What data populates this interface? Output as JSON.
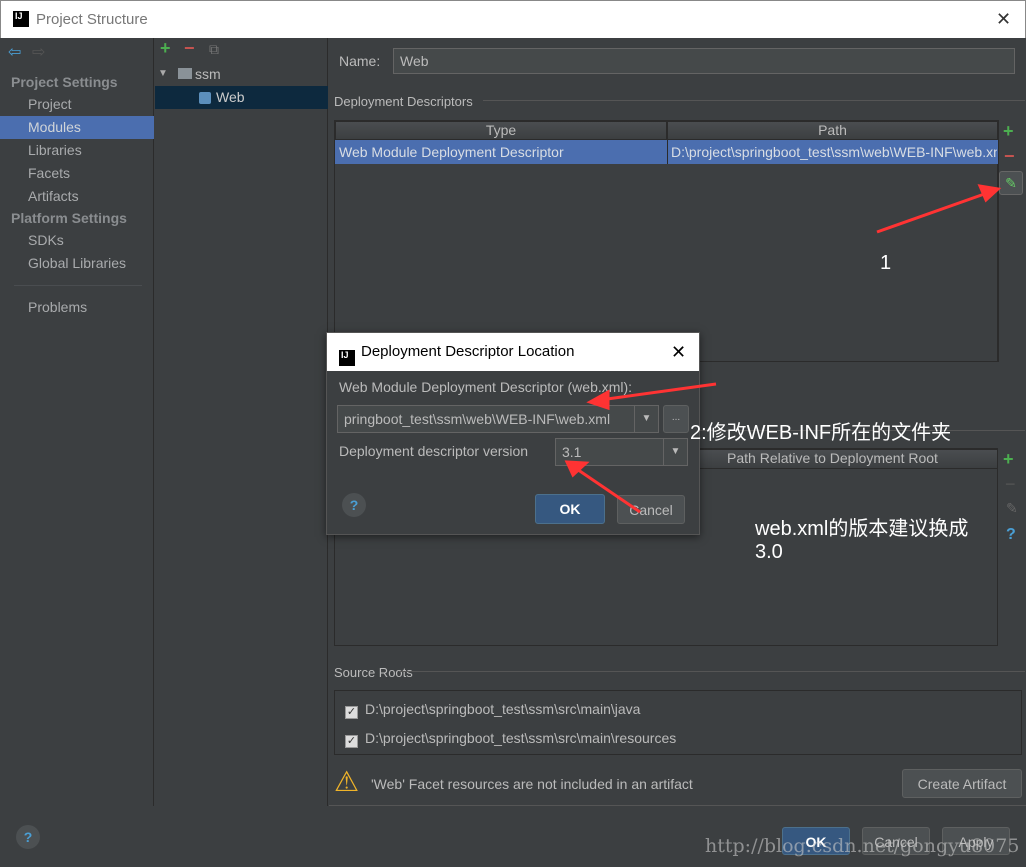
{
  "window": {
    "title": "Project Structure",
    "close": "✕"
  },
  "sidebar": {
    "sections": [
      {
        "header": "Project Settings",
        "items": [
          "Project",
          "Modules",
          "Libraries",
          "Facets",
          "Artifacts"
        ]
      },
      {
        "header": "Platform Settings",
        "items": [
          "SDKs",
          "Global Libraries"
        ]
      }
    ],
    "problems": "Problems",
    "selected": "Modules"
  },
  "tree": {
    "root": "ssm",
    "child": "Web"
  },
  "main": {
    "name_label": "Name:",
    "name_value": "Web",
    "descriptors_title": "Deployment Descriptors",
    "table": {
      "columns": [
        "Type",
        "Path"
      ],
      "rows": [
        [
          "Web Module Deployment Descriptor",
          "D:\\project\\springboot_test\\ssm\\web\\WEB-INF\\web.xml"
        ]
      ]
    },
    "web_resources_column": "Path Relative to Deployment Root",
    "source_roots_title": "Source Roots",
    "source_roots": [
      {
        "path": "D:\\project\\springboot_test\\ssm\\src\\main\\java",
        "checked": true
      },
      {
        "path": "D:\\project\\springboot_test\\ssm\\src\\main\\resources",
        "checked": true
      }
    ],
    "warning": "'Web' Facet resources are not included in an artifact",
    "create_artifact": "Create Artifact"
  },
  "footer": {
    "ok": "OK",
    "cancel": "Cancel",
    "apply": "Apply",
    "help": "?"
  },
  "dialog": {
    "title": "Deployment Descriptor Location",
    "descriptor_label": "Web Module Deployment Descriptor (web.xml):",
    "descriptor_value": "pringboot_test\\ssm\\web\\WEB-INF\\web.xml",
    "browse": "...",
    "version_label": "Deployment descriptor version",
    "version_value": "3.1",
    "ok": "OK",
    "cancel": "Cancel",
    "help": "?"
  },
  "annotations": {
    "step1": "1",
    "step2": "2:修改WEB-INF所在的文件夹",
    "step3_line1": "web.xml的版本建议换成",
    "step3_line2": "3.0",
    "arrow_color": "#ff3333"
  },
  "watermark": "http://blog.csdn.net/gongyu8075"
}
